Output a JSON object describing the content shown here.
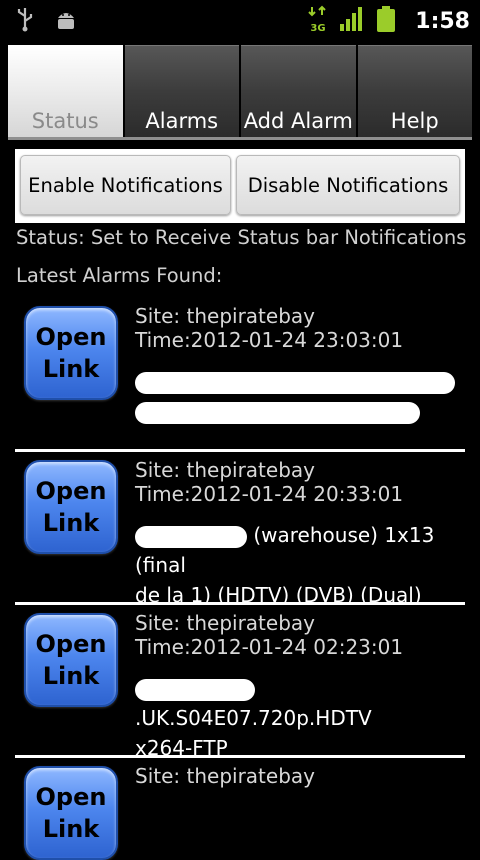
{
  "statusbar": {
    "time": "1:58",
    "network": "3G",
    "icons": [
      "usb-icon",
      "android-debug-icon",
      "data-3g-icon",
      "signal-icon",
      "battery-icon"
    ]
  },
  "tabs": [
    {
      "label": "Status",
      "active": true
    },
    {
      "label": "Alarms",
      "active": false
    },
    {
      "label": "Add Alarm",
      "active": false
    },
    {
      "label": "Help",
      "active": false
    }
  ],
  "buttons": {
    "enable": "Enable Notifications",
    "disable": "Disable Notifications"
  },
  "status_text": "Status: Set to Receive Status bar Notifications",
  "latest_label": "Latest Alarms Found:",
  "open_link": {
    "line1": "Open",
    "line2": "Link"
  },
  "alarms": [
    {
      "site": "Site: thepiratebay",
      "time": "Time:2012-01-24 23:03:01",
      "title_line1": "",
      "title_line2": ""
    },
    {
      "site": "Site: thepiratebay",
      "time": "Time:2012-01-24 20:33:01",
      "title_line1": " (warehouse) 1x13 (final",
      "title_line2": "de la 1) (HDTV) (DVB) (Dual)"
    },
    {
      "site": "Site: thepiratebay",
      "time": "Time:2012-01-24 02:23:01",
      "title_line1": ".UK.S04E07.720p.HDTV",
      "title_line2": "x264-FTP"
    },
    {
      "site": "Site: thepiratebay",
      "time": "",
      "title_line1": "",
      "title_line2": ""
    }
  ],
  "colors": {
    "open_button": "#4d86ee",
    "active_tab": "#ffffff",
    "inactive_tab": "#3c3c3c"
  }
}
